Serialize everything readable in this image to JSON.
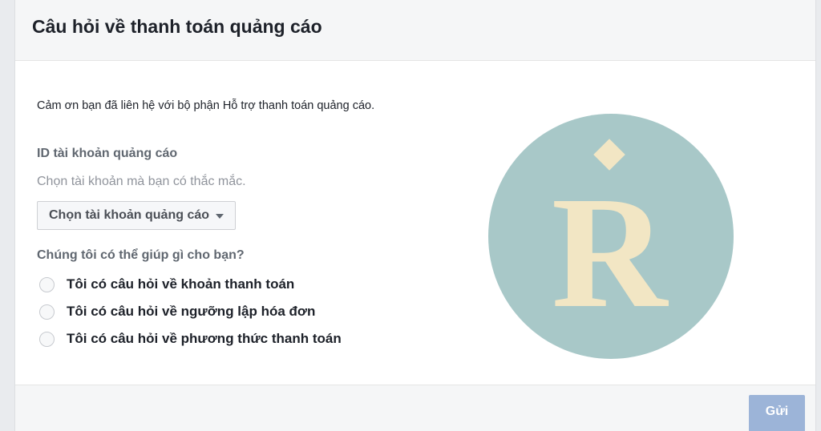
{
  "dialog": {
    "title": "Câu hỏi về thanh toán quảng cáo",
    "intro": "Cảm ơn bạn đã liên hệ với bộ phận Hỗ trợ thanh toán quảng cáo."
  },
  "account": {
    "label": "ID tài khoản quảng cáo",
    "hint": "Chọn tài khoản mà bạn có thắc mắc.",
    "select_label": "Chọn tài khoản quảng cáo"
  },
  "help": {
    "label": "Chúng tôi có thể giúp gì cho bạn?",
    "options": [
      {
        "label": "Tôi có câu hỏi về khoản thanh toán",
        "selected": false
      },
      {
        "label": "Tôi có câu hỏi về ngưỡng lập hóa đơn",
        "selected": false
      },
      {
        "label": "Tôi có câu hỏi về phương thức thanh toán",
        "selected": false
      }
    ]
  },
  "logo": {
    "letter": "R",
    "circle_color": "#a8c8c8",
    "letter_color": "#f2e6c4"
  },
  "footer": {
    "send_label": "Gửi",
    "send_color": "#9cb4d8"
  }
}
